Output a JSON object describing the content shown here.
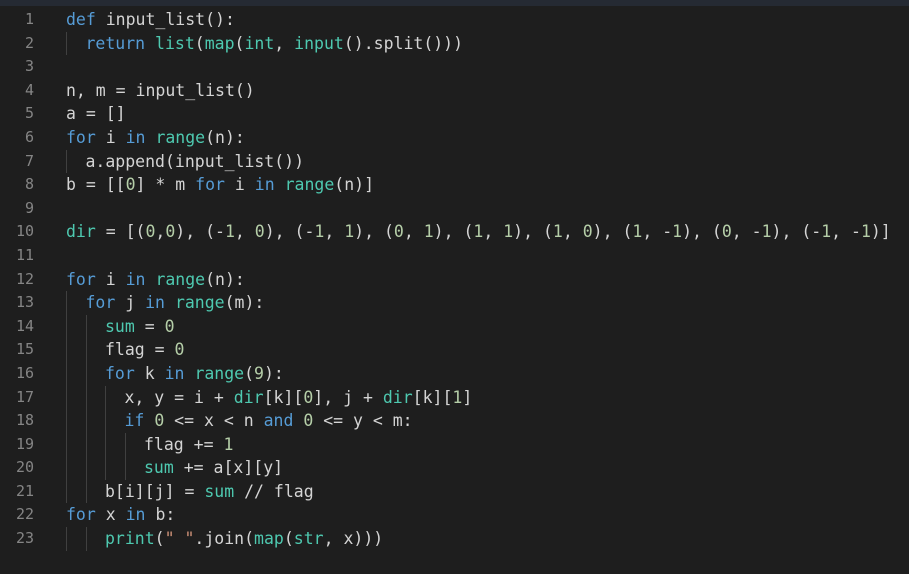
{
  "editor": {
    "colors": {
      "background": "#1e1e1e",
      "line_number": "#858585",
      "text": "#d4d4d4",
      "keyword": "#569cd6",
      "builtin": "#4ec9b0",
      "function": "#dcdcaa",
      "number": "#b5cea8",
      "string": "#ce9178"
    },
    "lines": [
      {
        "number": "1",
        "indent": 0,
        "tokens": [
          {
            "t": "def ",
            "c": "kw"
          },
          {
            "t": "input_list():",
            "c": "id"
          }
        ]
      },
      {
        "number": "2",
        "indent": 1,
        "tokens": [
          {
            "t": "return ",
            "c": "kw"
          },
          {
            "t": "list",
            "c": "bi"
          },
          {
            "t": "(",
            "c": "id"
          },
          {
            "t": "map",
            "c": "bi"
          },
          {
            "t": "(",
            "c": "id"
          },
          {
            "t": "int",
            "c": "bi"
          },
          {
            "t": ", ",
            "c": "id"
          },
          {
            "t": "input",
            "c": "bi"
          },
          {
            "t": "().split()))",
            "c": "id"
          }
        ]
      },
      {
        "number": "3",
        "indent": 0,
        "tokens": []
      },
      {
        "number": "4",
        "indent": 0,
        "tokens": [
          {
            "t": "n, m = input_list()",
            "c": "id"
          }
        ]
      },
      {
        "number": "5",
        "indent": 0,
        "tokens": [
          {
            "t": "a = []",
            "c": "id"
          }
        ]
      },
      {
        "number": "6",
        "indent": 0,
        "tokens": [
          {
            "t": "for ",
            "c": "kw"
          },
          {
            "t": "i ",
            "c": "id"
          },
          {
            "t": "in ",
            "c": "kw"
          },
          {
            "t": "range",
            "c": "bi"
          },
          {
            "t": "(n):",
            "c": "id"
          }
        ]
      },
      {
        "number": "7",
        "indent": 1,
        "tokens": [
          {
            "t": "a.append(input_list())",
            "c": "id"
          }
        ]
      },
      {
        "number": "8",
        "indent": 0,
        "tokens": [
          {
            "t": "b = [[",
            "c": "id"
          },
          {
            "t": "0",
            "c": "num"
          },
          {
            "t": "] * m ",
            "c": "id"
          },
          {
            "t": "for ",
            "c": "kw"
          },
          {
            "t": "i ",
            "c": "id"
          },
          {
            "t": "in ",
            "c": "kw"
          },
          {
            "t": "range",
            "c": "bi"
          },
          {
            "t": "(n)]",
            "c": "id"
          }
        ]
      },
      {
        "number": "9",
        "indent": 0,
        "tokens": []
      },
      {
        "number": "10",
        "indent": 0,
        "tokens": [
          {
            "t": "dir",
            "c": "bi"
          },
          {
            "t": " = [(",
            "c": "id"
          },
          {
            "t": "0",
            "c": "num"
          },
          {
            "t": ",",
            "c": "id"
          },
          {
            "t": "0",
            "c": "num"
          },
          {
            "t": "), (-",
            "c": "id"
          },
          {
            "t": "1",
            "c": "num"
          },
          {
            "t": ", ",
            "c": "id"
          },
          {
            "t": "0",
            "c": "num"
          },
          {
            "t": "), (-",
            "c": "id"
          },
          {
            "t": "1",
            "c": "num"
          },
          {
            "t": ", ",
            "c": "id"
          },
          {
            "t": "1",
            "c": "num"
          },
          {
            "t": "), (",
            "c": "id"
          },
          {
            "t": "0",
            "c": "num"
          },
          {
            "t": ", ",
            "c": "id"
          },
          {
            "t": "1",
            "c": "num"
          },
          {
            "t": "), (",
            "c": "id"
          },
          {
            "t": "1",
            "c": "num"
          },
          {
            "t": ", ",
            "c": "id"
          },
          {
            "t": "1",
            "c": "num"
          },
          {
            "t": "), (",
            "c": "id"
          },
          {
            "t": "1",
            "c": "num"
          },
          {
            "t": ", ",
            "c": "id"
          },
          {
            "t": "0",
            "c": "num"
          },
          {
            "t": "), (",
            "c": "id"
          },
          {
            "t": "1",
            "c": "num"
          },
          {
            "t": ", -",
            "c": "id"
          },
          {
            "t": "1",
            "c": "num"
          },
          {
            "t": "), (",
            "c": "id"
          },
          {
            "t": "0",
            "c": "num"
          },
          {
            "t": ", -",
            "c": "id"
          },
          {
            "t": "1",
            "c": "num"
          },
          {
            "t": "), (-",
            "c": "id"
          },
          {
            "t": "1",
            "c": "num"
          },
          {
            "t": ", -",
            "c": "id"
          },
          {
            "t": "1",
            "c": "num"
          },
          {
            "t": ")]",
            "c": "id"
          }
        ]
      },
      {
        "number": "11",
        "indent": 0,
        "tokens": []
      },
      {
        "number": "12",
        "indent": 0,
        "tokens": [
          {
            "t": "for ",
            "c": "kw"
          },
          {
            "t": "i ",
            "c": "id"
          },
          {
            "t": "in ",
            "c": "kw"
          },
          {
            "t": "range",
            "c": "bi"
          },
          {
            "t": "(n):",
            "c": "id"
          }
        ]
      },
      {
        "number": "13",
        "indent": 1,
        "tokens": [
          {
            "t": "for ",
            "c": "kw"
          },
          {
            "t": "j ",
            "c": "id"
          },
          {
            "t": "in ",
            "c": "kw"
          },
          {
            "t": "range",
            "c": "bi"
          },
          {
            "t": "(m):",
            "c": "id"
          }
        ]
      },
      {
        "number": "14",
        "indent": 2,
        "tokens": [
          {
            "t": "sum",
            "c": "bi"
          },
          {
            "t": " = ",
            "c": "id"
          },
          {
            "t": "0",
            "c": "num"
          }
        ]
      },
      {
        "number": "15",
        "indent": 2,
        "tokens": [
          {
            "t": "flag = ",
            "c": "id"
          },
          {
            "t": "0",
            "c": "num"
          }
        ]
      },
      {
        "number": "16",
        "indent": 2,
        "tokens": [
          {
            "t": "for ",
            "c": "kw"
          },
          {
            "t": "k ",
            "c": "id"
          },
          {
            "t": "in ",
            "c": "kw"
          },
          {
            "t": "range",
            "c": "bi"
          },
          {
            "t": "(",
            "c": "id"
          },
          {
            "t": "9",
            "c": "num"
          },
          {
            "t": "):",
            "c": "id"
          }
        ]
      },
      {
        "number": "17",
        "indent": 3,
        "tokens": [
          {
            "t": "x, y = i + ",
            "c": "id"
          },
          {
            "t": "dir",
            "c": "bi"
          },
          {
            "t": "[k][",
            "c": "id"
          },
          {
            "t": "0",
            "c": "num"
          },
          {
            "t": "], j + ",
            "c": "id"
          },
          {
            "t": "dir",
            "c": "bi"
          },
          {
            "t": "[k][",
            "c": "id"
          },
          {
            "t": "1",
            "c": "num"
          },
          {
            "t": "]",
            "c": "id"
          }
        ]
      },
      {
        "number": "18",
        "indent": 3,
        "tokens": [
          {
            "t": "if ",
            "c": "kw"
          },
          {
            "t": "0",
            "c": "num"
          },
          {
            "t": " <= x < n ",
            "c": "id"
          },
          {
            "t": "and ",
            "c": "kw"
          },
          {
            "t": "0",
            "c": "num"
          },
          {
            "t": " <= y < m:",
            "c": "id"
          }
        ]
      },
      {
        "number": "19",
        "indent": 4,
        "tokens": [
          {
            "t": "flag += ",
            "c": "id"
          },
          {
            "t": "1",
            "c": "num"
          }
        ]
      },
      {
        "number": "20",
        "indent": 4,
        "tokens": [
          {
            "t": "sum",
            "c": "bi"
          },
          {
            "t": " += a[x][y]",
            "c": "id"
          }
        ]
      },
      {
        "number": "21",
        "indent": 2,
        "tokens": [
          {
            "t": "b[i][j] = ",
            "c": "id"
          },
          {
            "t": "sum",
            "c": "bi"
          },
          {
            "t": " // flag",
            "c": "id"
          }
        ]
      },
      {
        "number": "22",
        "indent": 0,
        "tokens": [
          {
            "t": "for ",
            "c": "kw"
          },
          {
            "t": "x ",
            "c": "id"
          },
          {
            "t": "in ",
            "c": "kw"
          },
          {
            "t": "b:",
            "c": "id"
          }
        ]
      },
      {
        "number": "23",
        "indent": 2,
        "tokens": [
          {
            "t": "print",
            "c": "bi"
          },
          {
            "t": "(",
            "c": "id"
          },
          {
            "t": "\" \"",
            "c": "str"
          },
          {
            "t": ".join(",
            "c": "id"
          },
          {
            "t": "map",
            "c": "bi"
          },
          {
            "t": "(",
            "c": "id"
          },
          {
            "t": "str",
            "c": "bi"
          },
          {
            "t": ", x)))",
            "c": "id"
          }
        ]
      }
    ]
  }
}
